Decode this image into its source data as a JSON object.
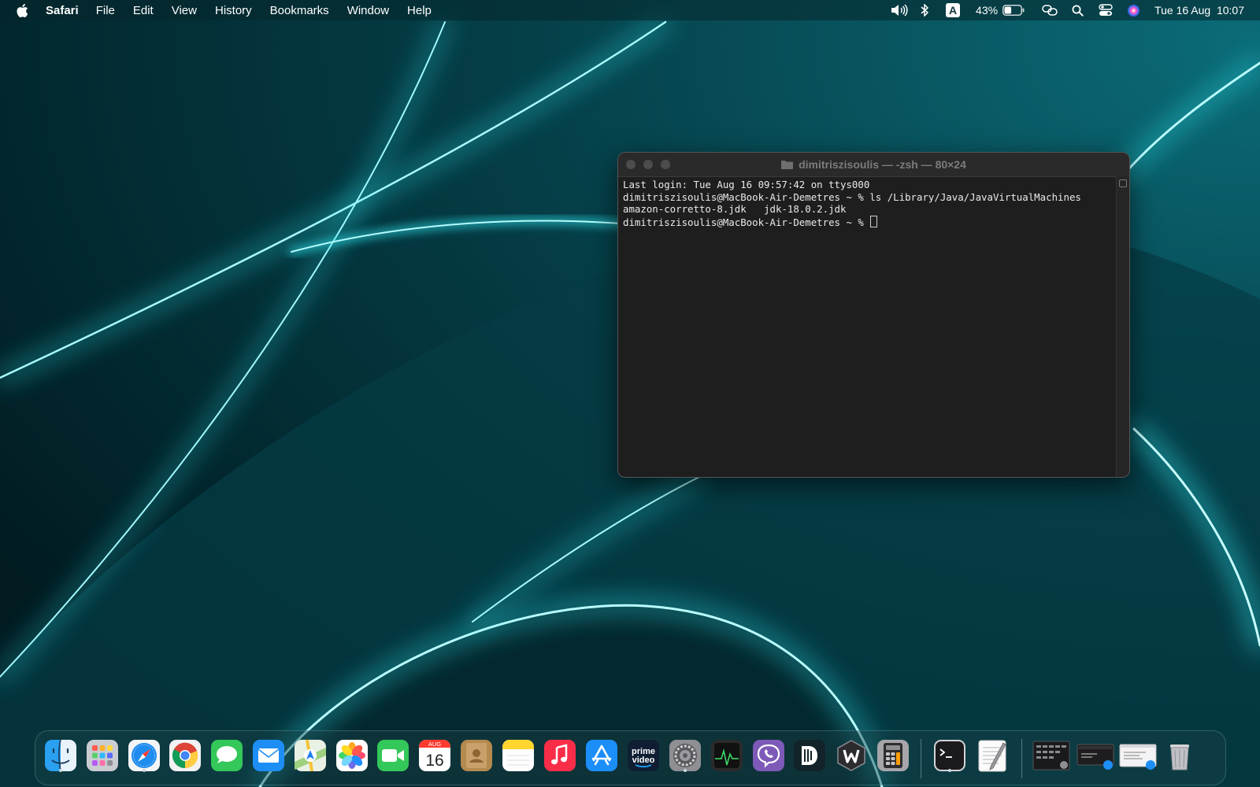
{
  "menubar": {
    "app_name": "Safari",
    "menus": [
      "File",
      "Edit",
      "View",
      "History",
      "Bookmarks",
      "Window",
      "Help"
    ],
    "status": {
      "input_source": "A",
      "battery_percent": "43%",
      "battery_level": 0.43,
      "datetime": "Tue 16 Aug  10:07"
    },
    "status_icons": [
      "volume-icon",
      "bluetooth-icon",
      "input-source-icon",
      "battery-icon",
      "screen-mirroring-icon",
      "spotlight-search-icon",
      "control-center-icon",
      "siri-icon"
    ]
  },
  "terminal": {
    "title": "dimitriszisoulis — -zsh — 80×24",
    "lines": [
      "Last login: Tue Aug 16 09:57:42 on ttys000",
      "dimitriszisoulis@MacBook-Air-Demetres ~ % ls /Library/Java/JavaVirtualMachines",
      "amazon-corretto-8.jdk   jdk-18.0.2.jdk",
      "dimitriszisoulis@MacBook-Air-Demetres ~ % "
    ]
  },
  "dock": {
    "calendar": {
      "month": "AUG",
      "day": "16"
    },
    "prime_video": {
      "line1": "prime",
      "line2": "video"
    },
    "apps": [
      {
        "name": "Finder",
        "icon": "finder-icon",
        "running": true
      },
      {
        "name": "Launchpad",
        "icon": "launchpad-icon",
        "running": false
      },
      {
        "name": "Safari",
        "icon": "safari-icon",
        "running": true
      },
      {
        "name": "Google Chrome",
        "icon": "chrome-icon",
        "running": false
      },
      {
        "name": "Messages",
        "icon": "messages-icon",
        "running": false
      },
      {
        "name": "Mail",
        "icon": "mail-icon",
        "running": false
      },
      {
        "name": "Maps",
        "icon": "maps-icon",
        "running": false
      },
      {
        "name": "Photos",
        "icon": "photos-icon",
        "running": false
      },
      {
        "name": "FaceTime",
        "icon": "facetime-icon",
        "running": false
      },
      {
        "name": "Calendar",
        "icon": "calendar-icon",
        "running": false
      },
      {
        "name": "Contacts",
        "icon": "contacts-icon",
        "running": false
      },
      {
        "name": "Notes",
        "icon": "notes-icon",
        "running": false
      },
      {
        "name": "Music",
        "icon": "music-icon",
        "running": false
      },
      {
        "name": "App Store",
        "icon": "app-store-icon",
        "running": false
      },
      {
        "name": "Prime Video",
        "icon": "prime-video-icon",
        "running": false
      },
      {
        "name": "System Preferences",
        "icon": "system-preferences-icon",
        "running": true
      },
      {
        "name": "Activity Monitor",
        "icon": "activity-monitor-icon",
        "running": false
      },
      {
        "name": "Viber",
        "icon": "viber-icon",
        "running": false
      },
      {
        "name": "Dashlane",
        "icon": "dashlane-icon",
        "running": false
      },
      {
        "name": "Wondershare",
        "icon": "wondershare-icon",
        "running": false
      },
      {
        "name": "Calculator",
        "icon": "calculator-icon",
        "running": false
      },
      {
        "name": "Terminal",
        "icon": "terminal-icon",
        "running": true
      },
      {
        "name": "TextEdit",
        "icon": "textedit-icon",
        "running": false
      },
      {
        "name": "Screenshot 1",
        "icon": "screenshot-thumbnail-icon",
        "running": false
      },
      {
        "name": "Screenshot 2",
        "icon": "screenshot-thumbnail-icon",
        "running": false
      },
      {
        "name": "Screenshot 3",
        "icon": "screenshot-thumbnail-icon",
        "running": false
      },
      {
        "name": "Trash",
        "icon": "trash-icon",
        "running": false
      }
    ]
  },
  "colors": {
    "wallpaper_dark": "#02252c",
    "wallpaper_glow": "#33f2f5",
    "terminal_bg": "#1e1e1e",
    "terminal_text": "#eaeaea"
  }
}
